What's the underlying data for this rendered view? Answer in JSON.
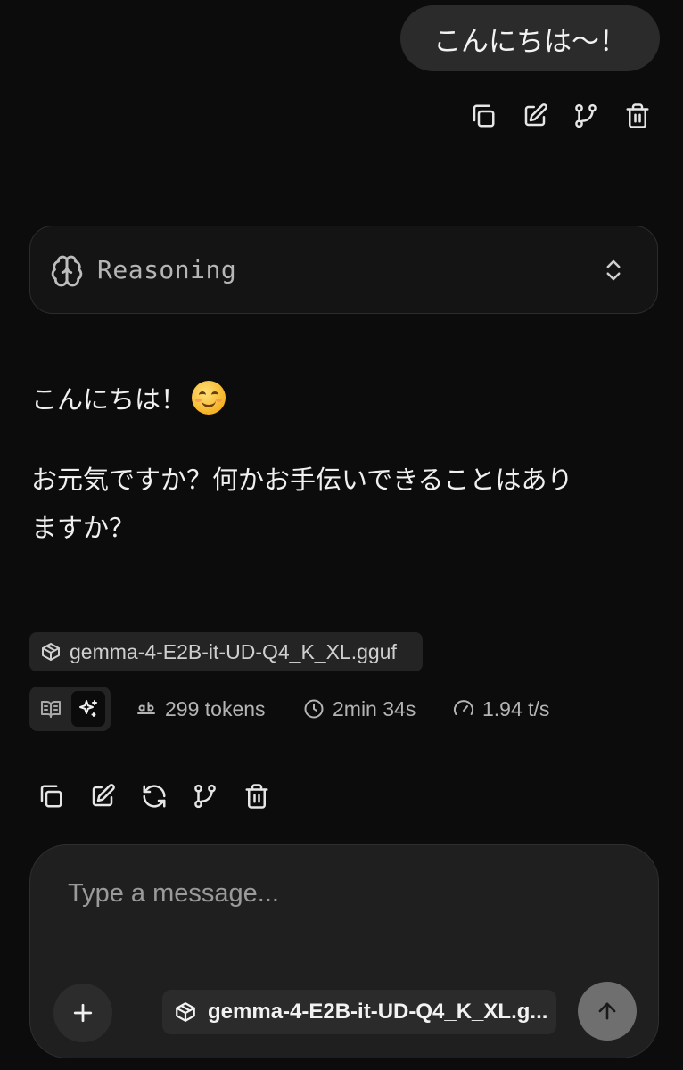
{
  "user_message": {
    "text": "こんにちは〜！",
    "actions": [
      "copy-icon",
      "edit-icon",
      "branch-icon",
      "trash-icon"
    ]
  },
  "reasoning": {
    "label": "Reasoning",
    "icon": "brain-icon",
    "toggle_icon": "chevrons-up-down-icon"
  },
  "assistant_message": {
    "line1": "こんにちは！",
    "line1_emoji": "smiling-face-emoji",
    "paragraph2_line1": "お元気ですか？何かお手伝いできることはあり",
    "paragraph2_line2": "ますか？"
  },
  "meta": {
    "model": "gemma-4-E2B-it-UD-Q4_K_XL.gguf",
    "view_toggles": [
      "book-open-icon",
      "sparkles-icon"
    ],
    "active_toggle": "sparkles-icon",
    "tokens": "299 tokens",
    "duration": "2min 34s",
    "speed": "1.94 t/s"
  },
  "assistant_actions": [
    "copy-icon",
    "edit-icon",
    "regenerate-icon",
    "branch-icon",
    "trash-icon"
  ],
  "composer": {
    "placeholder": "Type a message...",
    "model_label": "gemma-4-E2B-it-UD-Q4_K_XL.g..."
  },
  "colors": {
    "background": "#0c0c0c",
    "bubble": "#2b2b2b",
    "composer": "#1f1f1f",
    "send_button": "#6f6f6f"
  }
}
